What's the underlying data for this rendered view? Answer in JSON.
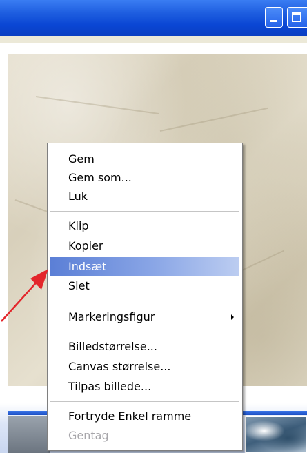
{
  "window": {
    "minimize_icon": "minimize-icon",
    "maximize_icon": "maximize-icon"
  },
  "context_menu": {
    "groups": [
      [
        "Gem",
        "Gem som...",
        "Luk"
      ],
      [
        "Klip",
        "Kopier",
        "Indsæt",
        "Slet"
      ],
      [
        "Markeringsfigur"
      ],
      [
        "Billedstørrelse...",
        "Canvas størrelse...",
        "Tilpas billede..."
      ],
      [
        "Fortryde Enkel ramme",
        "Gentag"
      ]
    ],
    "highlighted_item": "Indsæt",
    "disabled_item": "Gentag",
    "submenu_item": "Markeringsfigur"
  },
  "annotation": {
    "arrow_color": "#e3262b"
  },
  "colors": {
    "titlebar": "#0a46d4",
    "highlight": "#5b7fd6"
  }
}
